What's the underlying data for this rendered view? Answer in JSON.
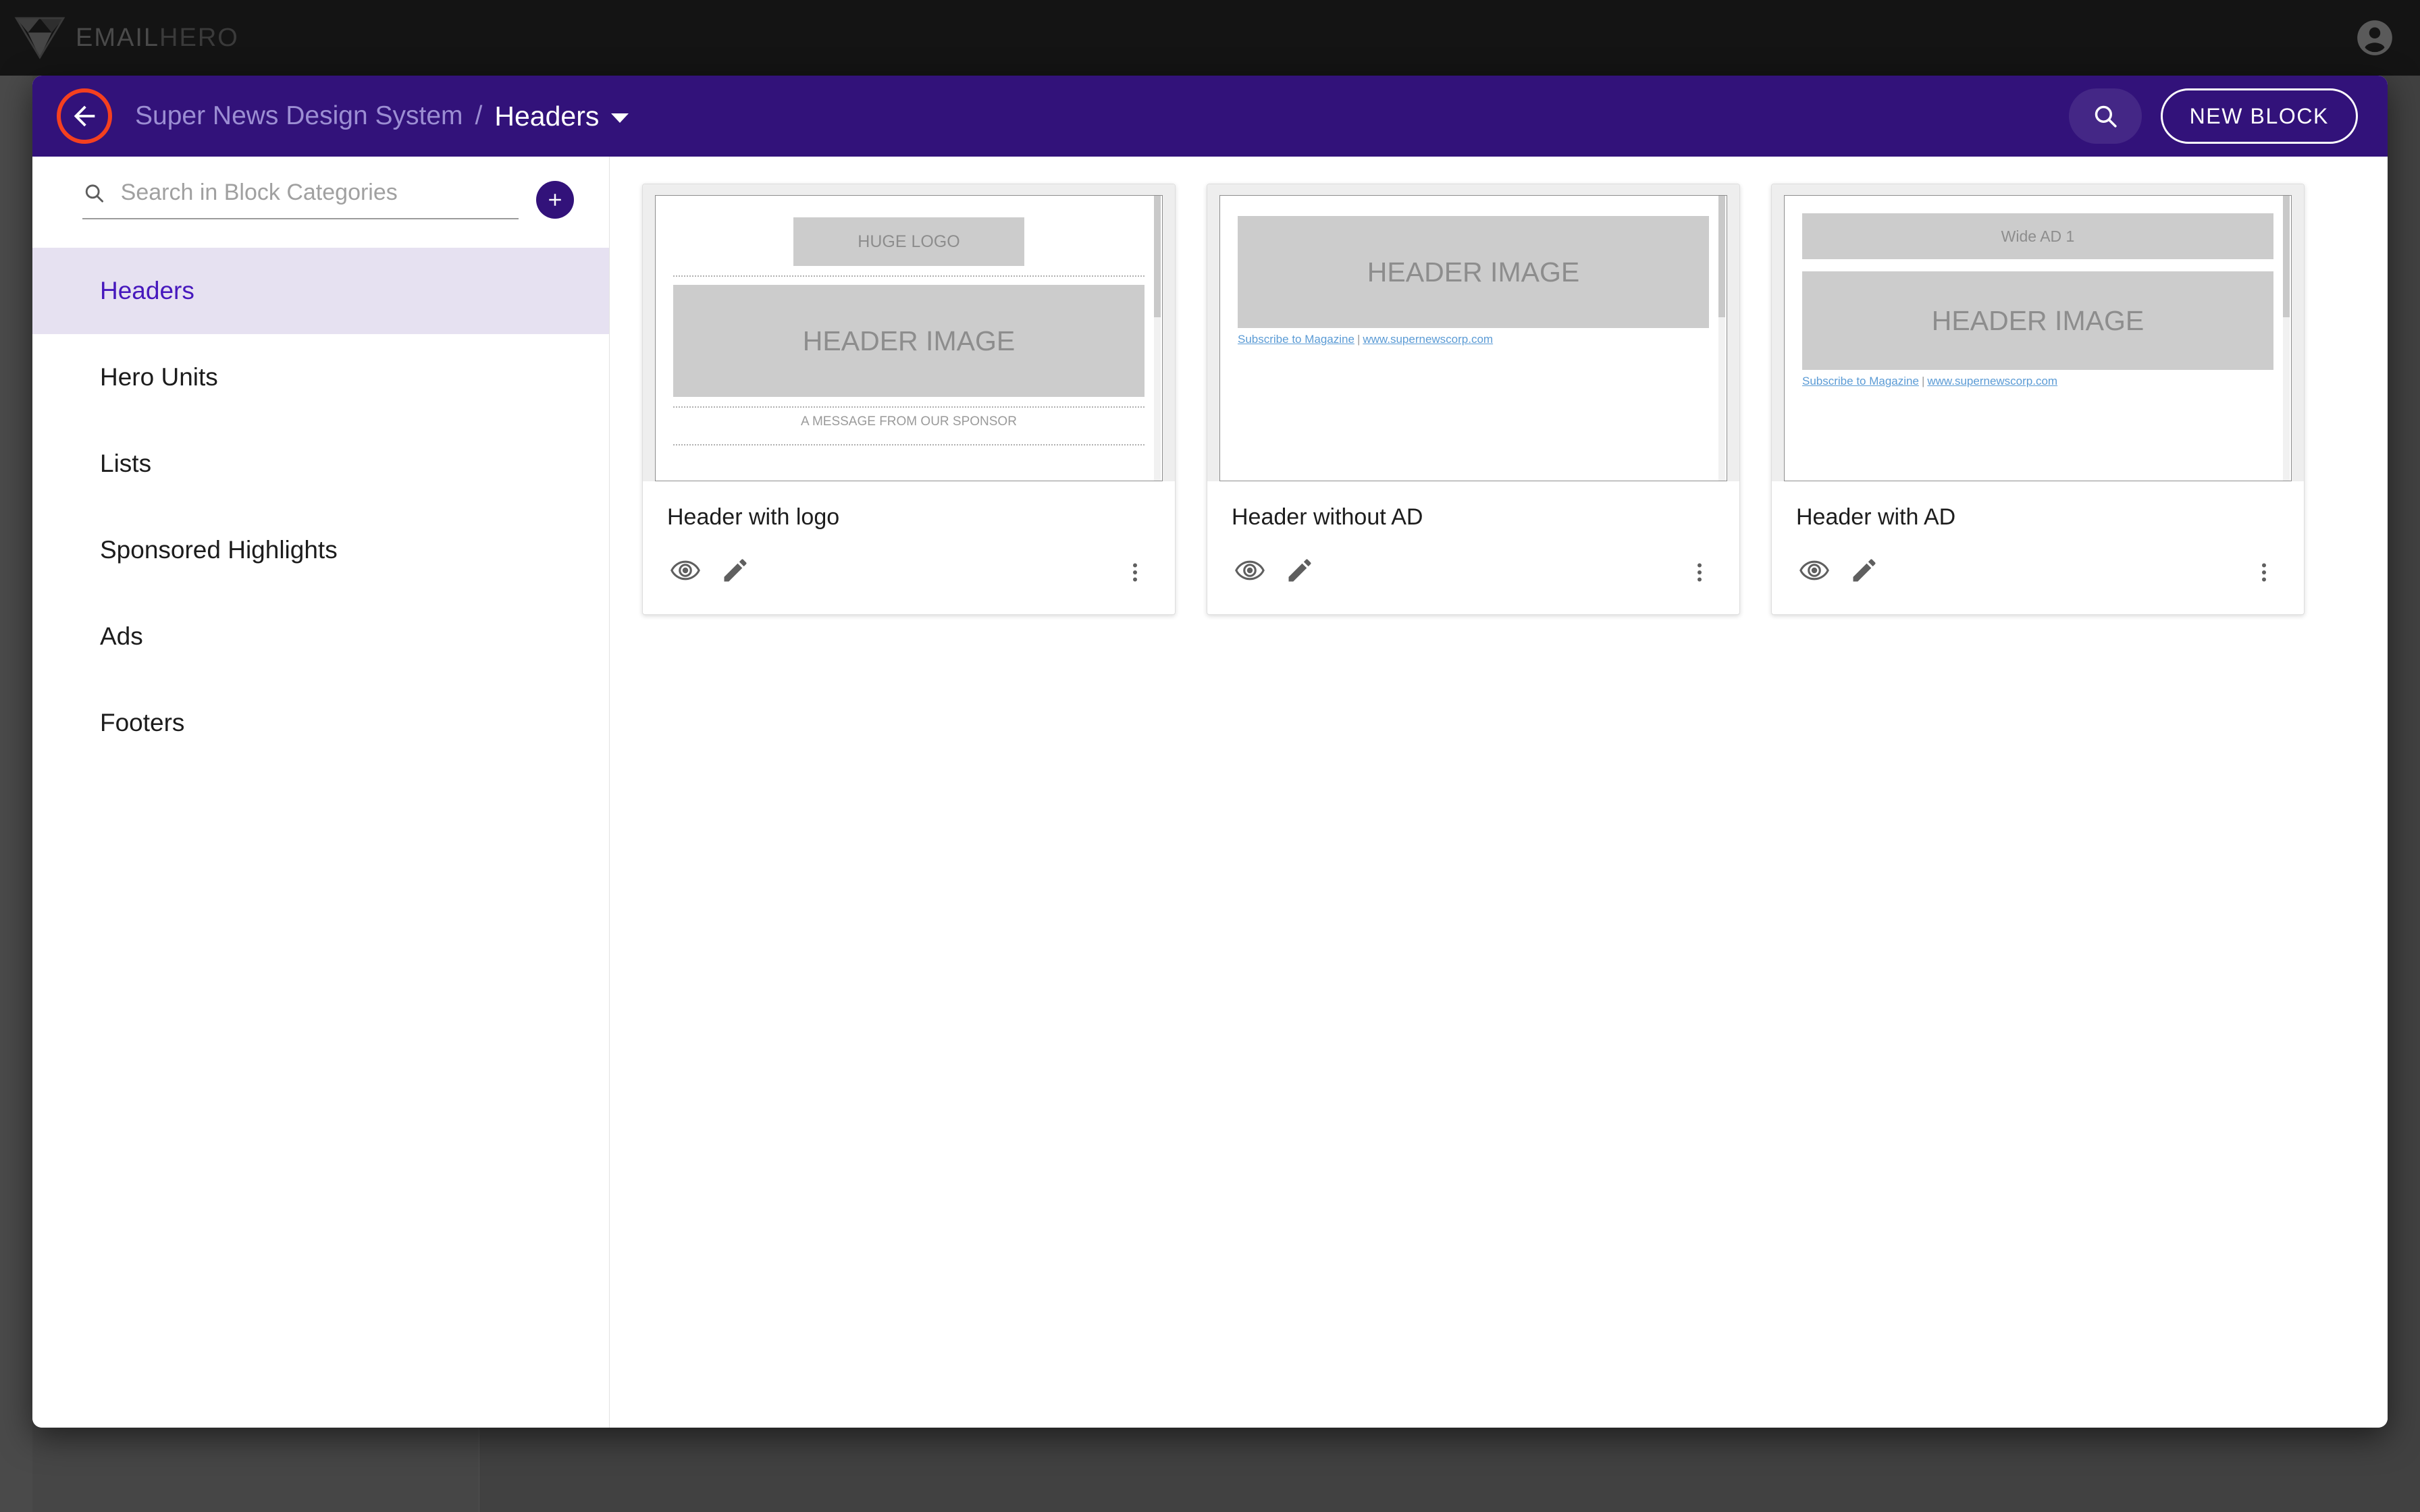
{
  "app": {
    "brand_primary": "EMAIL",
    "brand_secondary": "HERO",
    "logo_icon": "chevron-diamond-logo",
    "avatar_icon": "account-circle-icon"
  },
  "modal": {
    "toolbar": {
      "back_icon": "arrow-left-icon",
      "breadcrumb_parent": "Super News Design System",
      "breadcrumb_separator": "/",
      "breadcrumb_current": "Headers",
      "caret_icon": "chevron-down-icon",
      "search_icon": "search-icon",
      "new_block_label": "NEW BLOCK",
      "accent_purple": "#32127A",
      "highlight_color": "#F5401F"
    },
    "sidebar": {
      "search_placeholder": "Search in Block Categories",
      "search_value": "",
      "search_icon": "search-icon",
      "add_icon": "plus-icon",
      "selected_index": 0,
      "selected_bg": "#E6E1F1",
      "selected_text_color": "#4618BD",
      "items": [
        {
          "label": "Headers"
        },
        {
          "label": "Hero Units"
        },
        {
          "label": "Lists"
        },
        {
          "label": "Sponsored Highlights"
        },
        {
          "label": "Ads"
        },
        {
          "label": "Footers"
        }
      ]
    },
    "blocks": [
      {
        "title": "Header with logo",
        "preview": {
          "logo_placeholder": "HUGE LOGO",
          "header_image_placeholder": "HEADER IMAGE",
          "sponsor_text": "A MESSAGE FROM OUR SPONSOR"
        },
        "actions": {
          "preview_icon": "eye-icon",
          "edit_icon": "pencil-icon",
          "more_icon": "more-vertical-icon"
        }
      },
      {
        "title": "Header without AD",
        "preview": {
          "header_image_placeholder": "HEADER IMAGE",
          "subscribe_label": "Subscribe to Magazine",
          "link_separator": "|",
          "site_url": "www.supernewscorp.com"
        },
        "actions": {
          "preview_icon": "eye-icon",
          "edit_icon": "pencil-icon",
          "more_icon": "more-vertical-icon"
        }
      },
      {
        "title": "Header with AD",
        "preview": {
          "ad_placeholder": "Wide AD 1",
          "header_image_placeholder": "HEADER IMAGE",
          "subscribe_label": "Subscribe to Magazine",
          "link_separator": "|",
          "site_url": "www.supernewscorp.com"
        },
        "actions": {
          "preview_icon": "eye-icon",
          "edit_icon": "pencil-icon",
          "more_icon": "more-vertical-icon"
        }
      }
    ]
  }
}
